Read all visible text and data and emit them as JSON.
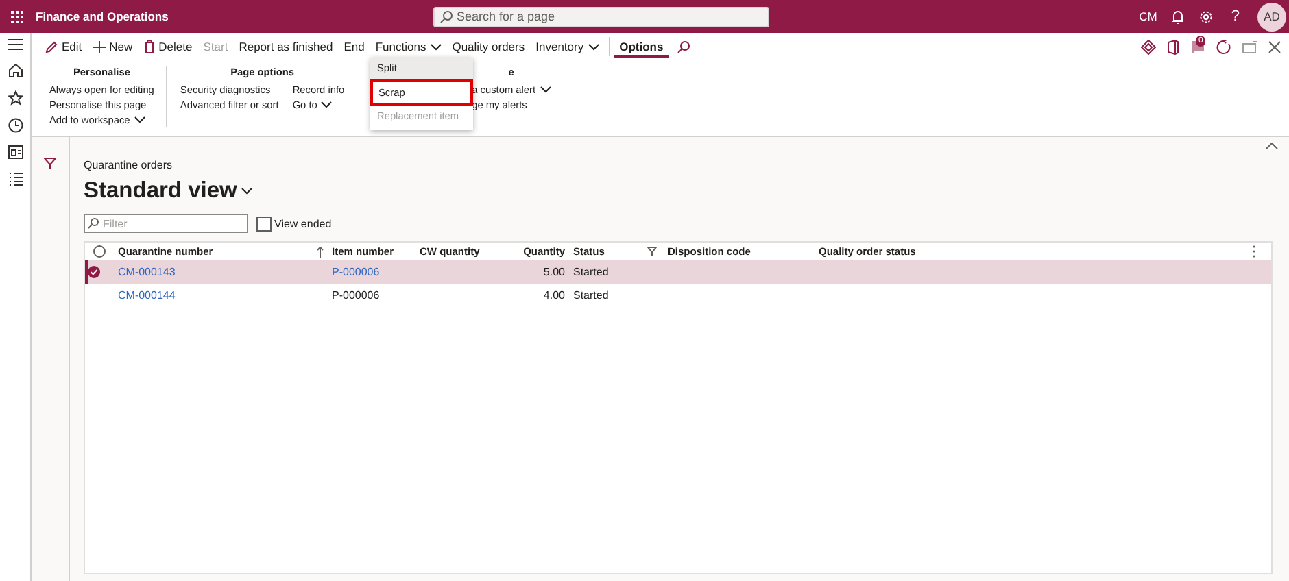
{
  "topbar": {
    "app_title": "Finance and Operations",
    "search": {
      "placeholder": "Search for a page"
    },
    "company": "CM",
    "help": "?",
    "avatar": "AD"
  },
  "actions": [
    {
      "label": "Edit",
      "kind": "edit",
      "disabled": false
    },
    {
      "label": "New",
      "kind": "new",
      "disabled": false
    },
    {
      "label": "Delete",
      "kind": "delete",
      "disabled": false
    },
    {
      "label": "Start",
      "kind": "plain",
      "disabled": true
    },
    {
      "label": "Report as finished",
      "kind": "plain",
      "disabled": false
    },
    {
      "label": "End",
      "kind": "plain",
      "disabled": false
    },
    {
      "label": "Functions",
      "kind": "menu",
      "disabled": false
    },
    {
      "label": "Quality orders",
      "kind": "plain",
      "disabled": false
    },
    {
      "label": "Inventory",
      "kind": "menu",
      "disabled": false
    }
  ],
  "tabs": [
    {
      "label": "Options",
      "selected": true
    }
  ],
  "notification_badge": "0",
  "ribbon": [
    {
      "title": "Personalise",
      "columns": [
        [
          {
            "label": "Always open for editing",
            "dropdown": false
          },
          {
            "label": "Personalise this page",
            "dropdown": false
          },
          {
            "label": "Add to workspace",
            "dropdown": true
          }
        ]
      ]
    },
    {
      "title": "Page options",
      "columns": [
        [
          {
            "label": "Security diagnostics",
            "dropdown": false
          },
          {
            "label": "Advanced filter or sort",
            "dropdown": false
          }
        ],
        [
          {
            "label": "Record info",
            "dropdown": false
          },
          {
            "label": "Go to",
            "dropdown": true
          }
        ]
      ]
    },
    {
      "title": "e",
      "columns": [
        [
          {
            "label": "a custom alert",
            "dropdown": true
          },
          {
            "label": "ge my alerts",
            "dropdown": false
          }
        ]
      ]
    }
  ],
  "menu": {
    "items": [
      {
        "label": "Split",
        "highlighted": true,
        "outlined": false,
        "disabled": false
      },
      {
        "label": "Scrap",
        "highlighted": false,
        "outlined": true,
        "disabled": false
      },
      {
        "label": "Replacement item",
        "highlighted": false,
        "outlined": false,
        "disabled": true
      }
    ]
  },
  "page": {
    "breadcrumb": "Quarantine orders",
    "view_title": "Standard view",
    "filter": {
      "placeholder": "Filter"
    },
    "view_ended": {
      "label": "View ended",
      "checked": false
    }
  },
  "grid": {
    "select_all": {
      "checked": false
    },
    "columns": [
      "Quarantine number",
      "Item number",
      "CW quantity",
      "Quantity",
      "Status",
      "Disposition code",
      "Quality order status"
    ],
    "rows": [
      {
        "selected": true,
        "quarantine_number": "CM-000143",
        "item_number": "P-000006",
        "item_number_link": true,
        "quantity": "5.00",
        "status": "Started"
      },
      {
        "selected": false,
        "quarantine_number": "CM-000144",
        "item_number": "P-000006",
        "item_number_link": false,
        "quantity": "4.00",
        "status": "Started"
      }
    ]
  }
}
